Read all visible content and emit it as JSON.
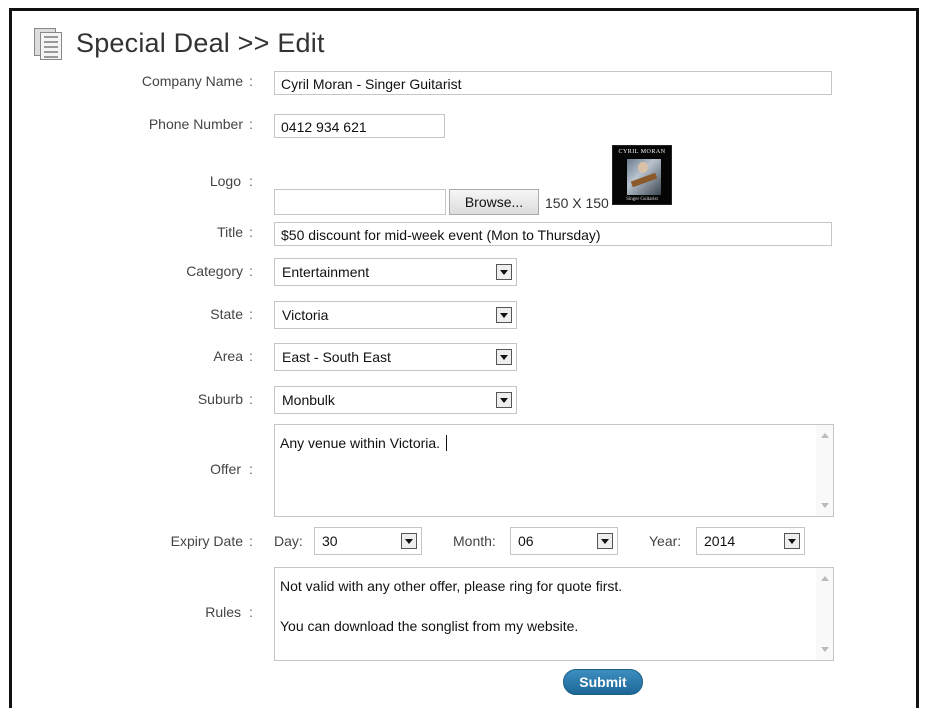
{
  "page": {
    "title": "Special Deal >> Edit"
  },
  "form": {
    "company_name": {
      "label": "Company Name",
      "value": "Cyril Moran - Singer Guitarist"
    },
    "phone_number": {
      "label": "Phone Number",
      "value": "0412 934 621"
    },
    "logo": {
      "label": "Logo",
      "file_value": "",
      "browse_label": "Browse...",
      "size_note": "150 X 150",
      "image_text_top": "CYRIL MORAN",
      "image_text_bottom": "Singer Guitarist"
    },
    "title": {
      "label": "Title",
      "value": "$50 discount for mid-week event (Mon to Thursday)"
    },
    "category": {
      "label": "Category",
      "value": "Entertainment"
    },
    "state": {
      "label": "State",
      "value": "Victoria"
    },
    "area": {
      "label": "Area",
      "value": "East - South East"
    },
    "suburb": {
      "label": "Suburb",
      "value": "Monbulk"
    },
    "offer": {
      "label": "Offer",
      "value": "Any venue within Victoria."
    },
    "expiry_date": {
      "label": "Expiry Date",
      "day_label": "Day:",
      "day_value": "30",
      "month_label": "Month:",
      "month_value": "06",
      "year_label": "Year:",
      "year_value": "2014"
    },
    "rules": {
      "label": "Rules",
      "value": "Not valid with any other offer, please ring for quote first.\n\nYou can download the songlist from my website."
    },
    "colon": ":",
    "submit_label": "Submit"
  }
}
